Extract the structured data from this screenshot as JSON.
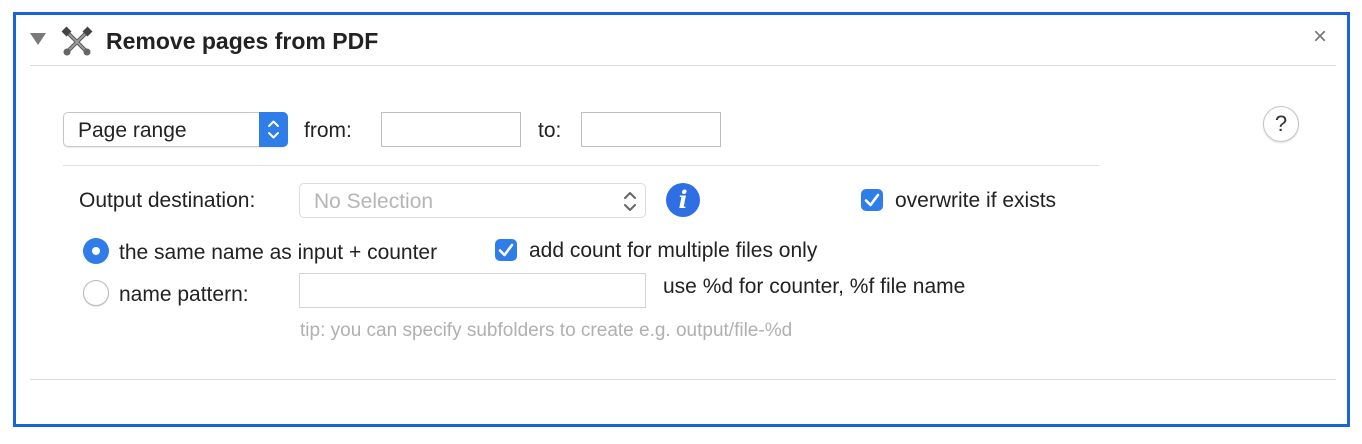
{
  "header": {
    "title": "Remove pages from PDF",
    "disclosure_icon": "disclosure-triangle-down",
    "action_icon": "crossed-tools-icon",
    "close_icon": "close-x",
    "close_glyph": "×"
  },
  "range": {
    "mode_selected": "Page range",
    "from_label": "from:",
    "from_value": "",
    "to_label": "to:",
    "to_value": "",
    "help_glyph": "?"
  },
  "output": {
    "destination_label": "Output destination:",
    "destination_selected": "No Selection",
    "info_glyph": "i",
    "overwrite_label": "overwrite if exists",
    "overwrite_checked": true
  },
  "naming": {
    "same_name_label": "the same name as input + counter",
    "same_name_selected": true,
    "add_count_label": "add count for multiple files only",
    "add_count_checked": true,
    "pattern_label": "name pattern:",
    "pattern_selected": false,
    "pattern_value": "",
    "pattern_hint": "use %d for counter, %f file name",
    "tip": "tip: you can specify subfolders to create e.g. output/file-%d"
  },
  "colors": {
    "accent": "#2f7de9",
    "panel_border": "#1b64d8",
    "info_icon": "#2f6fe4"
  }
}
